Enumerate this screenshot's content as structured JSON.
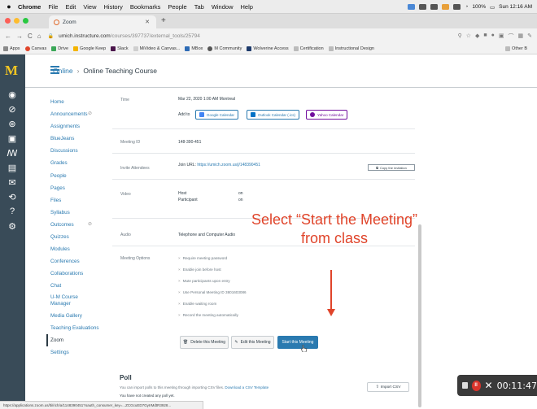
{
  "menubar": {
    "app": "Chrome",
    "items": [
      "File",
      "Edit",
      "View",
      "History",
      "Bookmarks",
      "People",
      "Tab",
      "Window",
      "Help"
    ],
    "battery": "100%",
    "clock": "Sun 12:16 AM"
  },
  "browser": {
    "tab_title": "Zoom",
    "url_host": "umich.instructure.com",
    "url_path": "/courses/397737/external_tools/25794",
    "bookmarks": [
      "Apps",
      "Canvas",
      "Drive",
      "Google Keep",
      "Slack",
      "MiVideo & Canvas...",
      "MBox",
      "M Community",
      "Wolverine Access",
      "Certification",
      "Instructional Design"
    ],
    "other_bookmarks": "Other B"
  },
  "header": {
    "crumb": "Online",
    "current": "Online Teaching Course"
  },
  "course_nav": [
    {
      "label": "Home"
    },
    {
      "label": "Announcements",
      "hidden": true
    },
    {
      "label": "Assignments"
    },
    {
      "label": "BlueJeans"
    },
    {
      "label": "Discussions"
    },
    {
      "label": "Grades"
    },
    {
      "label": "People"
    },
    {
      "label": "Pages"
    },
    {
      "label": "Files"
    },
    {
      "label": "Syllabus"
    },
    {
      "label": "Outcomes",
      "hidden": true
    },
    {
      "label": "Quizzes"
    },
    {
      "label": "Modules"
    },
    {
      "label": "Conferences"
    },
    {
      "label": "Collaborations"
    },
    {
      "label": "Chat"
    },
    {
      "label": "U-M Course Manager"
    },
    {
      "label": "Media Gallery"
    },
    {
      "label": "Teaching Evaluations"
    },
    {
      "label": "Zoom",
      "active": true
    },
    {
      "label": "Settings"
    }
  ],
  "meeting": {
    "time_label": "Time",
    "time_value": "Mar 22, 2020 1:00 AM  Montreal",
    "add_to": "Add to",
    "google_calendar": "Google Calendar",
    "outlook_calendar": "Outlook Calendar (.ics)",
    "yahoo_calendar": "Yahoo Calendar",
    "id_label": "Meeting ID",
    "id_value": "148-390-451",
    "invite_label": "Invite Attendees",
    "join_url_label": "Join URL:",
    "join_url": "https://umich.zoom.us/j/148390451",
    "copy_invitation": "Copy the invitation",
    "video_label": "Video",
    "host_label": "Host",
    "host_value": "on",
    "participant_label": "Participant",
    "participant_value": "on",
    "audio_label": "Audio",
    "audio_value": "Telephone and Computer Audio",
    "options_label": "Meeting Options",
    "options": [
      "Require meeting password",
      "Enable join before host",
      "Mute participants upon entry",
      "Use Personal Meeting ID 3801603086",
      "Enable waiting room",
      "Record the meeting automatically"
    ],
    "delete_button": "Delete this Meeting",
    "edit_button": "Edit this Meeting",
    "start_button": "Start this Meeting"
  },
  "poll": {
    "title": "Poll",
    "description": "You can import polls to this meeting through importing CSV files.",
    "template_link": "Download a CSV Template",
    "empty": "You have not created any poll yet.",
    "import_button": "Import CSV"
  },
  "annotation": {
    "line1": "Select “Start the Meeting”",
    "line2": "from class",
    "color": "#e0442a"
  },
  "status_url": "https://applications.zoom.us/lti/rich/a/1148390451?oauth_consumer_key=...ZCGcuED7GyIrMdtR3928...",
  "recorder": {
    "time": "00:11:47"
  },
  "colors": {
    "link": "#2a7ab0",
    "global_nav": "#394b58",
    "logo": "#f3c623"
  }
}
